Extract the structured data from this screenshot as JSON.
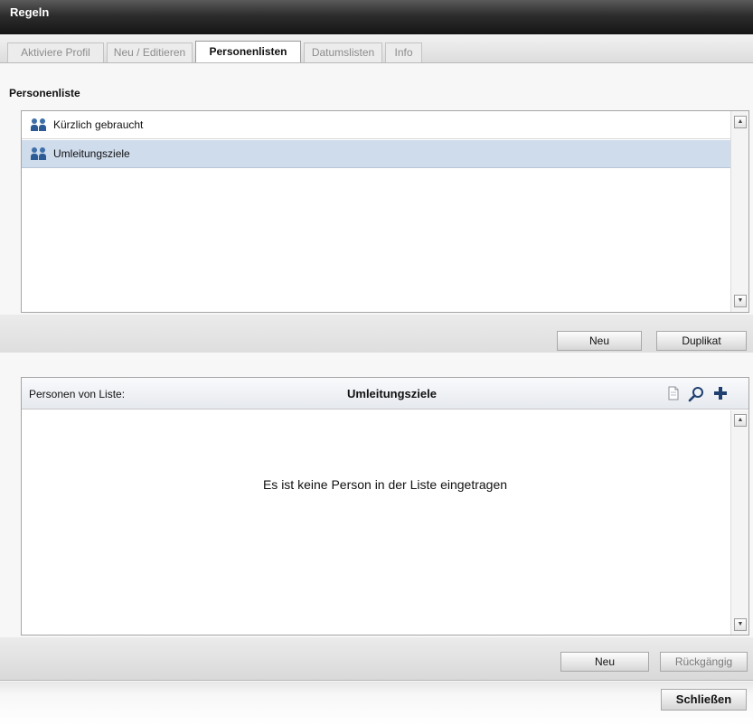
{
  "window": {
    "title": "Regeln"
  },
  "tabs": [
    {
      "label": "Aktiviere Profil",
      "active": false
    },
    {
      "label": "Neu / Editieren",
      "active": false
    },
    {
      "label": "Personenlisten",
      "active": true
    },
    {
      "label": "Datumslisten",
      "active": false
    },
    {
      "label": "Info",
      "active": false
    }
  ],
  "person_list": {
    "title": "Personenliste",
    "items": [
      {
        "label": "Kürzlich gebraucht",
        "icon": "people-icon",
        "selected": false
      },
      {
        "label": "Umleitungsziele",
        "icon": "people-icon",
        "selected": true
      }
    ],
    "new_label": "Neu",
    "duplicate_label": "Duplikat"
  },
  "persons_panel": {
    "label": "Personen von Liste:",
    "list_name": "Umleitungsziele",
    "icons": [
      "document-icon",
      "search-icon",
      "plus-icon"
    ],
    "empty_message": "Es ist keine Person in der Liste eingetragen",
    "new_label": "Neu",
    "undo_label": "Rückgängig"
  },
  "footer": {
    "close_label": "Schließen"
  },
  "colors": {
    "selected_row": "#cfdcec",
    "titlebar": "#2d2d2d",
    "people_icon": "#2c5b95"
  }
}
